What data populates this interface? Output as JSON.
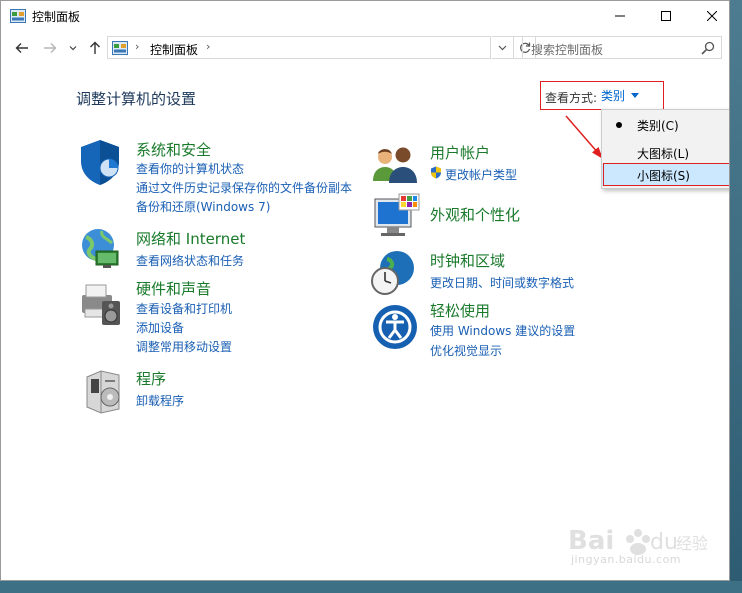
{
  "window": {
    "title": "控制面板"
  },
  "address": {
    "crumb": "控制面板"
  },
  "search": {
    "placeholder": "搜索控制面板"
  },
  "page": {
    "title": "调整计算机的设置"
  },
  "viewby": {
    "label": "查看方式:",
    "value": "类别",
    "options": [
      {
        "label": "类别(C)",
        "selected": true
      },
      {
        "label": "大图标(L)",
        "selected": false
      },
      {
        "label": "小图标(S)",
        "selected": false,
        "hover": true
      }
    ]
  },
  "categories": [
    {
      "title": "系统和安全",
      "icon": "shield-icon",
      "links": [
        "查看你的计算机状态",
        "通过文件历史记录保存你的文件备份副本",
        "备份和还原(Windows 7)"
      ]
    },
    {
      "title": "网络和 Internet",
      "icon": "network-icon",
      "links": [
        "查看网络状态和任务"
      ]
    },
    {
      "title": "硬件和声音",
      "icon": "printer-icon",
      "links": [
        "查看设备和打印机",
        "添加设备",
        "调整常用移动设置"
      ]
    },
    {
      "title": "程序",
      "icon": "programs-icon",
      "links": [
        "卸载程序"
      ]
    },
    {
      "title": "用户帐户",
      "icon": "users-icon",
      "links": [
        "更改帐户类型"
      ]
    },
    {
      "title": "外观和个性化",
      "icon": "monitor-icon",
      "links": []
    },
    {
      "title": "时钟和区域",
      "icon": "clock-globe-icon",
      "links": [
        "更改日期、时间或数字格式"
      ]
    },
    {
      "title": "轻松使用",
      "icon": "ease-of-access-icon",
      "links": [
        "使用 Windows 建议的设置",
        "优化视觉显示"
      ]
    }
  ],
  "watermark": {
    "brand": "Baidu 经验",
    "url": "jingyan.baidu.com"
  },
  "colors": {
    "link": "#1a5fb4",
    "category_title": "#1a7a2b",
    "highlight_border": "#e02020"
  }
}
